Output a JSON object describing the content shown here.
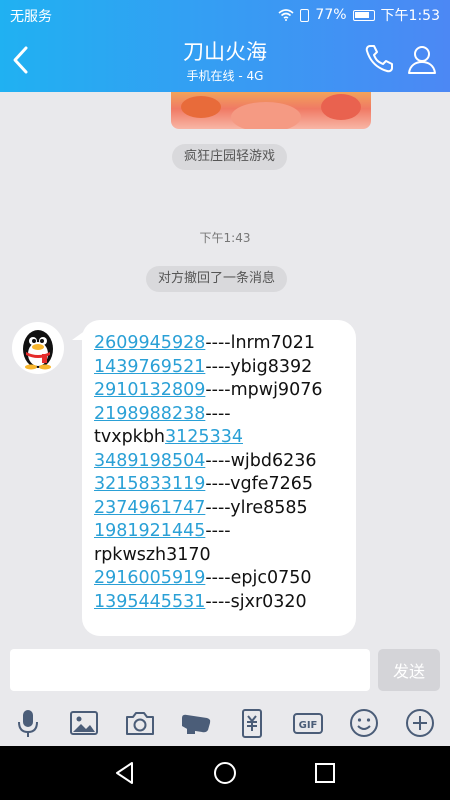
{
  "status_bar": {
    "carrier": "无服务",
    "battery": "77%",
    "time": "下午1:53"
  },
  "header": {
    "title": "刀山火海",
    "subtitle": "手机在线 - 4G",
    "icons": [
      "back-arrow-icon",
      "phone-icon",
      "profile-icon"
    ]
  },
  "chat": {
    "game_label": "疯狂庄园轻游戏",
    "timestamp": "下午1:43",
    "recall_notice": "对方撤回了一条消息",
    "message_lines": [
      {
        "link": "2609945928",
        "text": "----lnrm7021"
      },
      {
        "link": "1439769521",
        "text": "----ybig8392"
      },
      {
        "link": "2910132809",
        "text": "----mpwj9076"
      },
      {
        "link": "2198988238",
        "text": "----"
      },
      {
        "text_before": "tvxpkbh",
        "link": "3125334"
      },
      {
        "link": "3489198504",
        "text": "----wjbd6236"
      },
      {
        "link": "3215833119",
        "text": "----vgfe7265"
      },
      {
        "link": "2374961747",
        "text": "----ylre8585"
      },
      {
        "link": "1981921445",
        "text": "----"
      },
      {
        "text_before": "rpkwszh3170"
      },
      {
        "link": "2916005919",
        "text": "----epjc0750"
      },
      {
        "link": "1395445531",
        "text": "----sjxr0320"
      }
    ],
    "link_color": "#2aa0d6"
  },
  "input": {
    "value": "",
    "send_label": "发送"
  },
  "toolbar": {
    "icons": [
      "microphone-icon",
      "image-icon",
      "camera-icon",
      "red-packet-icon",
      "wallet-icon",
      "gif-icon",
      "emoji-icon",
      "plus-icon"
    ]
  },
  "colors": {
    "header_start": "#20b1f2",
    "header_end": "#4c88f4",
    "background": "#e9e9ec"
  }
}
